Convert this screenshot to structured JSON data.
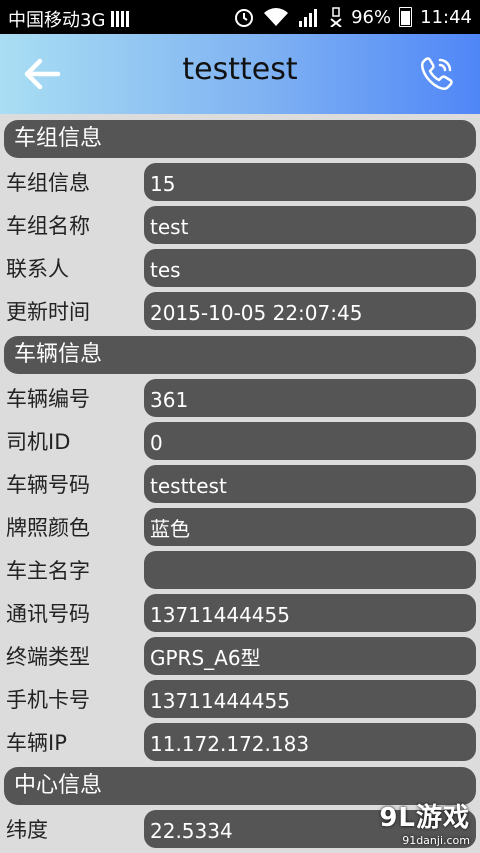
{
  "statusbar": {
    "carrier": "中国移动3G",
    "battery": "96%",
    "time": "11:44"
  },
  "header": {
    "title": "testtest",
    "back_icon": "arrow-left-icon",
    "call_icon": "phone-icon"
  },
  "sections": {
    "group": {
      "title": "车组信息",
      "rows": [
        {
          "label": "车组信息",
          "value": "15"
        },
        {
          "label": "车组名称",
          "value": "test"
        },
        {
          "label": "联系人",
          "value": "tes"
        },
        {
          "label": "更新时间",
          "value": "2015-10-05 22:07:45"
        }
      ]
    },
    "vehicle": {
      "title": "车辆信息",
      "rows": [
        {
          "label": "车辆编号",
          "value": "361"
        },
        {
          "label": "司机ID",
          "value": "0"
        },
        {
          "label": "车辆号码",
          "value": "testtest"
        },
        {
          "label": "牌照颜色",
          "value": "蓝色"
        },
        {
          "label": "车主名字",
          "value": ""
        },
        {
          "label": "通讯号码",
          "value": "13711444455"
        },
        {
          "label": "终端类型",
          "value": "GPRS_A6型"
        },
        {
          "label": "手机卡号",
          "value": "13711444455"
        },
        {
          "label": "车辆IP",
          "value": "11.172.172.183"
        }
      ]
    },
    "center": {
      "title": "中心信息",
      "rows": [
        {
          "label": "纬度",
          "value": "22.5334"
        }
      ]
    }
  },
  "watermark": {
    "brand": "9L游戏",
    "site": "91danji.com"
  }
}
